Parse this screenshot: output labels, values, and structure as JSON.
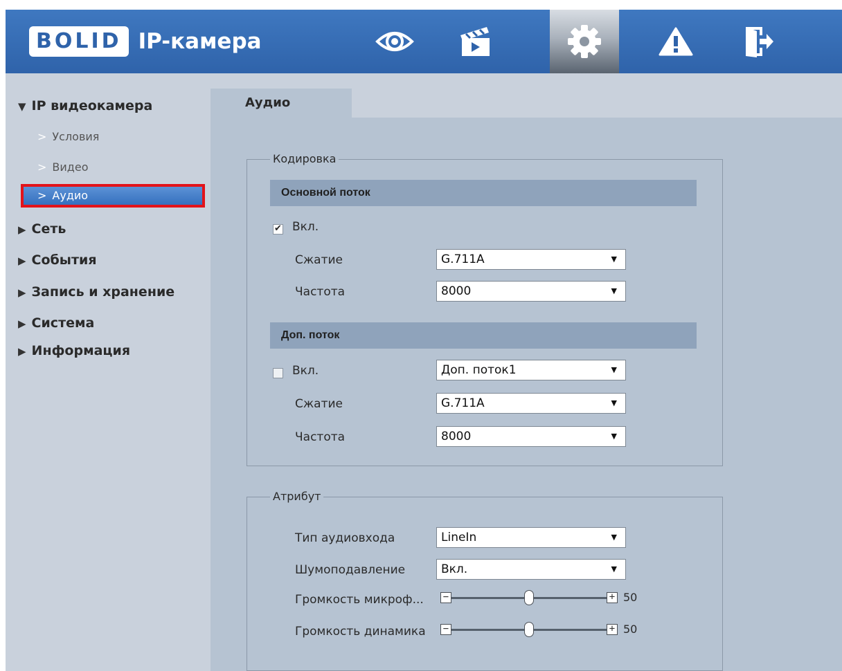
{
  "header": {
    "logo_text": "BOLID",
    "title": "IP-камера",
    "nav": [
      {
        "icon": "eye-icon"
      },
      {
        "icon": "clapperboard-icon"
      },
      {
        "icon": "gear-icon",
        "active": true
      },
      {
        "icon": "warning-icon"
      },
      {
        "icon": "logout-icon"
      }
    ]
  },
  "sidebar": {
    "sections": [
      {
        "label": "IP видеокамера",
        "expanded": true
      },
      {
        "label": "Сеть"
      },
      {
        "label": "События"
      },
      {
        "label": "Запись и хранение"
      },
      {
        "label": "Система"
      },
      {
        "label": "Информация"
      }
    ],
    "subitems": [
      {
        "label": "Условия"
      },
      {
        "label": "Видео"
      },
      {
        "label": "Аудио",
        "active": true
      }
    ]
  },
  "tab": {
    "label": "Аудио"
  },
  "encoding": {
    "legend": "Кодировка",
    "main": {
      "title": "Основной поток",
      "enable_label": "Вкл.",
      "enabled": true,
      "compression_label": "Сжатие",
      "compression": "G.711A",
      "frequency_label": "Частота",
      "frequency": "8000"
    },
    "sub": {
      "title": "Доп. поток",
      "enable_label": "Вкл.",
      "enabled": false,
      "stream": "Доп. поток1",
      "compression_label": "Сжатие",
      "compression": "G.711A",
      "frequency_label": "Частота",
      "frequency": "8000"
    }
  },
  "attribute": {
    "legend": "Атрибут",
    "input_type_label": "Тип аудиовхода",
    "input_type": "LineIn",
    "noise_label": "Шумоподавление",
    "noise": "Вкл.",
    "mic_label": "Громкость микроф...",
    "mic_value": "50",
    "mic_level": 0.5,
    "speaker_label": "Громкость динамика",
    "speaker_value": "50",
    "speaker_level": 0.5,
    "minus": "−",
    "plus": "+"
  },
  "dropdown_arrow": "▼"
}
